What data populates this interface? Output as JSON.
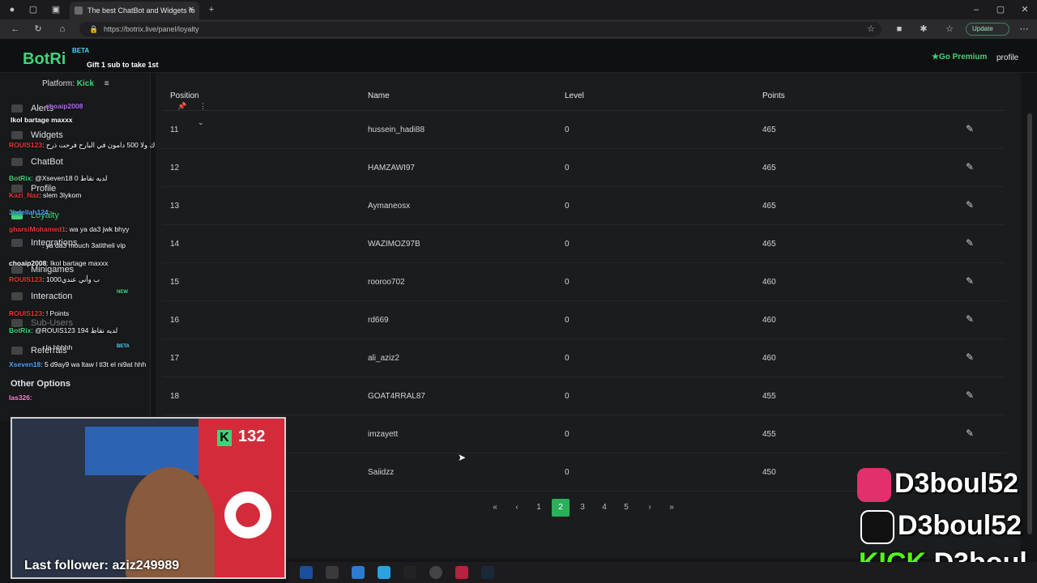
{
  "browser": {
    "tab_title": "The best ChatBot and Widgets fo",
    "url": "https://botrix.live/panel/loyalty",
    "update_label": "Update"
  },
  "header": {
    "logo": "BotRi",
    "beta": "BETA",
    "gift": "Gift 1 sub to take 1st",
    "go_premium": "Go Premium",
    "profile": "profile"
  },
  "sidebar": {
    "platform_label": "Platform: ",
    "platform_value": "Kick",
    "items": [
      {
        "label": "Alerts"
      },
      {
        "label": "Widgets"
      },
      {
        "label": "ChatBot"
      },
      {
        "label": "Profile"
      },
      {
        "label": "Loyalty"
      },
      {
        "label": "Integrations"
      },
      {
        "label": "Minigames"
      },
      {
        "label": "Interaction"
      },
      {
        "label": "Sub-Users"
      },
      {
        "label": "Referrals"
      }
    ],
    "new_badge": "NEW",
    "beta_badge": "BETA",
    "other_options": "Other Options"
  },
  "chat": [
    {
      "user": "choaip2008",
      "text": ""
    },
    {
      "user": "",
      "text": "Ikol bartage maxxx"
    },
    {
      "user": "ROUIS123",
      "text": ": عضوية الشهرية داك ولا 500 دامون في البارح فرحت ذرح"
    },
    {
      "user": "BotRix",
      "text": ": @Xseven18 0 لديه نقاط"
    },
    {
      "user": "Kazi_Naz",
      "text": ": slem 3lykom"
    },
    {
      "user": "3bdellah124",
      "text": ":"
    },
    {
      "user": "gharsiMohamed1",
      "text": ": wa ya da3 jwk bhyy"
    },
    {
      "user": "",
      "text": ": ya da3 mouch 3atitheli vip"
    },
    {
      "user": "choaip2008",
      "text": ": Ikol bartage maxxx"
    },
    {
      "user": "ROUIS123",
      "text": ": 1000ب وأني عندي"
    },
    {
      "user": "ROUIS123",
      "text": ": ! Points"
    },
    {
      "user": "BotRix",
      "text": ": @ROUIS123 194 لديه نقاط"
    },
    {
      "user": "",
      "text": ": la hhhhh"
    },
    {
      "user": "Xseven18",
      "text": ": 5 d9ay9 wa ltaw l tl3t el ni9at hhh"
    },
    {
      "user": "las326",
      "text": ":"
    }
  ],
  "table": {
    "headers": [
      "Position",
      "Name",
      "Level",
      "Points"
    ],
    "rows": [
      {
        "position": "11",
        "name": "hussein_hadi88",
        "level": "0",
        "points": "465"
      },
      {
        "position": "12",
        "name": "HAMZAWI97",
        "level": "0",
        "points": "465"
      },
      {
        "position": "13",
        "name": "Aymaneosx",
        "level": "0",
        "points": "465"
      },
      {
        "position": "14",
        "name": "WAZIMOZ97B",
        "level": "0",
        "points": "465"
      },
      {
        "position": "15",
        "name": "rooroo702",
        "level": "0",
        "points": "460"
      },
      {
        "position": "16",
        "name": "rd669",
        "level": "0",
        "points": "460"
      },
      {
        "position": "17",
        "name": "ali_aziz2",
        "level": "0",
        "points": "460"
      },
      {
        "position": "18",
        "name": "GOAT4RRAL87",
        "level": "0",
        "points": "455"
      },
      {
        "position": "",
        "name": "imzayett",
        "level": "0",
        "points": "455"
      },
      {
        "position": "",
        "name": "Saiidzz",
        "level": "0",
        "points": "450"
      }
    ]
  },
  "pagination": {
    "first": "«",
    "prev": "‹",
    "pages": [
      "1",
      "2",
      "3",
      "4",
      "5"
    ],
    "active": "2",
    "next": "›",
    "last": "»"
  },
  "stream": {
    "kick_count": "132",
    "last_follower": "Last follower: aziz249989",
    "socials": [
      {
        "platform": "instagram",
        "handle": "D3boul52",
        "color": "#e1306c"
      },
      {
        "platform": "tiktok",
        "handle": "D3boul52",
        "color": "#111111"
      },
      {
        "platform": "kick",
        "handle": "D3boul",
        "color": "#53fc18"
      }
    ]
  }
}
